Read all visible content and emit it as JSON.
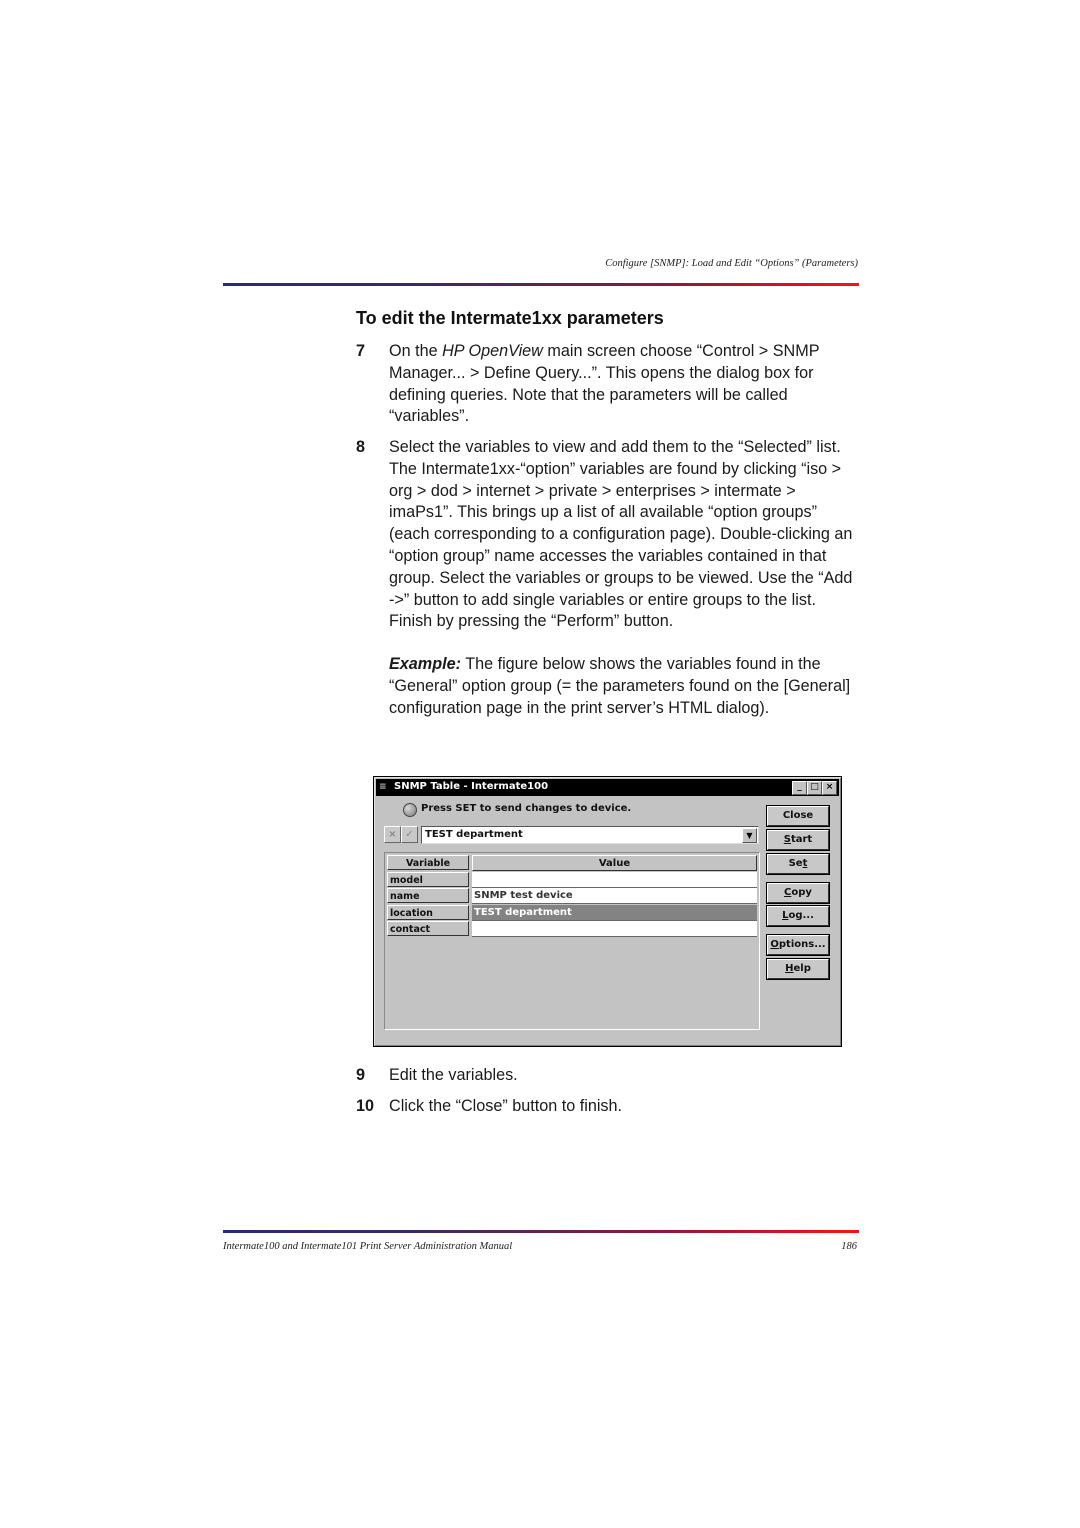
{
  "header": {
    "running_title": "Configure [SNMP]: Load and Edit “Options” (Parameters)"
  },
  "section": {
    "title": "To edit the Intermate1xx parameters"
  },
  "steps": [
    {
      "num": "7",
      "pre": "On the ",
      "em": "HP OpenView",
      "post": " main screen choose “Control > SNMP Manager... > Define Query...”. This opens the dialog box for defining queries. Note that the parameters will be called “variables”."
    },
    {
      "num": "8",
      "text": "Select the variables to view and add them to the “Selected” list. The Intermate1xx-“option” variables are found by clicking “iso > org > dod > internet > private > enterprises > intermate > imaPs1”. This brings up a list of all available “option groups” (each corresponding to a configuration page). Double-clicking an “option group” name accesses the variables contained in that group. Select the variables or groups to be viewed. Use the “Add ->” button to add single variables or entire groups to the list.",
      "finish": "Finish by pressing the “Perform” button.",
      "example_label": "Example:",
      "example_text": " The figure below shows the variables found in the “General” option group (= the parameters found on the [General] configuration page in the print server’s HTML dialog)."
    },
    {
      "num": "9",
      "text": "Edit the variables."
    },
    {
      "num": "10",
      "text": "Click the “Close” button to finish."
    }
  ],
  "dialog": {
    "title": "SNMP Table - Intermate100",
    "window_buttons": {
      "minimize": "_",
      "maximize": "□",
      "close": "×"
    },
    "status_text": "Press SET to send changes to device.",
    "cancel_icon": "×",
    "accept_icon": "✓",
    "combo_value": "TEST department",
    "combo_arrow": "▼",
    "columns": {
      "variable": "Variable",
      "value": "Value"
    },
    "rows": [
      {
        "variable": "model",
        "value": "",
        "selected": false
      },
      {
        "variable": "name",
        "value": "SNMP test device",
        "selected": false
      },
      {
        "variable": "location",
        "value": "TEST department",
        "selected": true
      },
      {
        "variable": "contact",
        "value": "",
        "selected": false
      }
    ],
    "buttons": {
      "close": "Close",
      "start_u": "S",
      "start_rest": "tart",
      "set_pre": "Se",
      "set_u": "t",
      "copy_u": "C",
      "copy_rest": "opy",
      "log_u": "L",
      "log_rest": "og...",
      "options_u": "O",
      "options_rest": "ptions...",
      "help_u": "H",
      "help_rest": "elp"
    }
  },
  "footer": {
    "manual_title": "Intermate100 and Intermate101 Print Server Administration Manual",
    "page_number": "186"
  }
}
